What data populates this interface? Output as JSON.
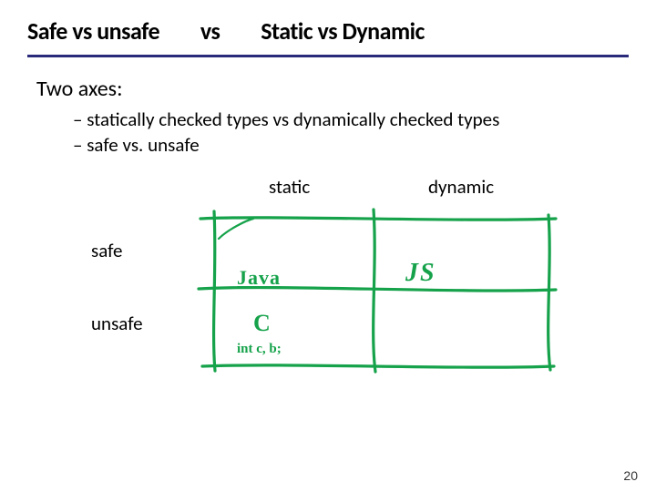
{
  "title": {
    "part1": "Safe vs unsafe",
    "part2": "vs",
    "part3": "Static  vs Dynamic"
  },
  "lead": "Two axes:",
  "bullets": [
    "statically checked types vs dynamically checked types",
    "safe vs. unsafe"
  ],
  "columns": {
    "static": "static",
    "dynamic": "dynamic"
  },
  "rows": {
    "safe": "safe",
    "unsafe": "unsafe"
  },
  "cells": {
    "safe_static": "Java",
    "safe_dynamic": "JS",
    "unsafe_static": "C",
    "unsafe_static_note": "int c, b;"
  },
  "page_number": "20"
}
